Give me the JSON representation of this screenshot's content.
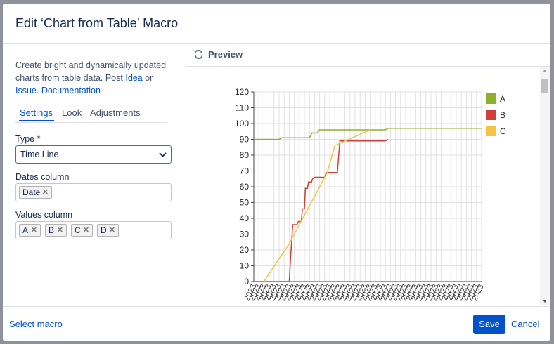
{
  "dialog": {
    "title": "Edit ‘Chart from Table’ Macro"
  },
  "sidebar": {
    "description_text": "Create bright and dynamically updated charts from table data. Post",
    "idea_link": "Idea",
    "or_text": "or",
    "issue_link": "Issue.",
    "documentation_link": "Documentation",
    "tabs": [
      {
        "label": "Settings",
        "active": true
      },
      {
        "label": "Look",
        "active": false
      },
      {
        "label": "Adjustments",
        "active": false
      }
    ],
    "type_label": "Type *",
    "type_value": "Time Line",
    "dates_label": "Dates column",
    "dates_chips": [
      "Date"
    ],
    "values_label": "Values column",
    "values_chips": [
      "A",
      "B",
      "C",
      "D"
    ]
  },
  "preview": {
    "title": "Preview"
  },
  "footer": {
    "select_macro": "Select macro",
    "save": "Save",
    "cancel": "Cancel"
  },
  "colors": {
    "accent": "#0052cc",
    "series_a": "#8fb02b",
    "series_b": "#d0403a",
    "series_c": "#f5c342"
  },
  "chart_data": {
    "type": "line",
    "ylim": [
      0,
      120
    ],
    "yticks": [
      0,
      10,
      20,
      30,
      40,
      50,
      60,
      70,
      80,
      90,
      100,
      110,
      120
    ],
    "xtick_label": "2023",
    "xtick_count": 46,
    "grid": true,
    "legend_position": "right",
    "series": [
      {
        "name": "A",
        "color": "#8fb02b",
        "points": [
          [
            0,
            90
          ],
          [
            5,
            90
          ],
          [
            5.5,
            91
          ],
          [
            11,
            91
          ],
          [
            11.5,
            94
          ],
          [
            12.5,
            94
          ],
          [
            13,
            96
          ],
          [
            26,
            96
          ],
          [
            26.5,
            97
          ],
          [
            45,
            97
          ]
        ]
      },
      {
        "name": "B",
        "color": "#d0403a",
        "points": [
          [
            0,
            0
          ],
          [
            7,
            0
          ],
          [
            7.3,
            17
          ],
          [
            7.7,
            36
          ],
          [
            8.5,
            36
          ],
          [
            8.8,
            38
          ],
          [
            9.4,
            38
          ],
          [
            9.6,
            46
          ],
          [
            10,
            46
          ],
          [
            10.2,
            59
          ],
          [
            10.6,
            59
          ],
          [
            10.8,
            63
          ],
          [
            11.4,
            63
          ],
          [
            11.6,
            65
          ],
          [
            12,
            66
          ],
          [
            14,
            66
          ],
          [
            14.3,
            69
          ],
          [
            16.5,
            69
          ],
          [
            17,
            89
          ],
          [
            26,
            89
          ],
          [
            26.5,
            90
          ]
        ]
      },
      {
        "name": "C",
        "color": "#f5c342",
        "points": [
          [
            2,
            0
          ],
          [
            7,
            24
          ],
          [
            14.5,
            69
          ],
          [
            16,
            86
          ],
          [
            23,
            96
          ]
        ]
      }
    ]
  }
}
